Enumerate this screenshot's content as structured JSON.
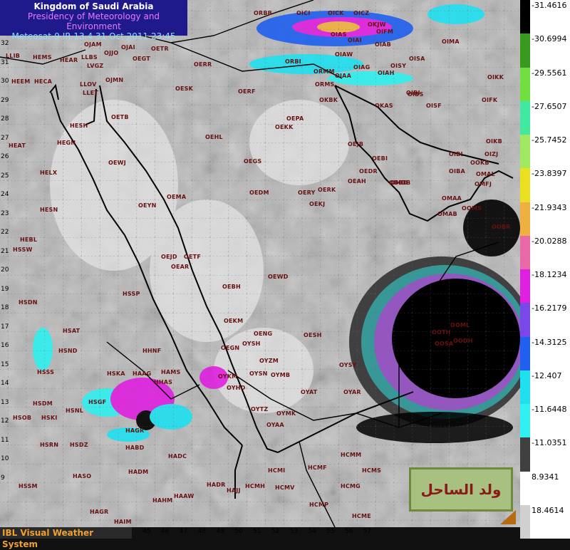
{
  "header": {
    "line1": "Kingdom of Saudi Arabia",
    "line2": "Presidency of Meteorology and Environment",
    "line3": "Meteosat-9 IR 13.4     31 Oct 2011 23:45"
  },
  "footer": {
    "text": "IBL Visual Weather System"
  },
  "stamp": {
    "text": "ولد الساحل"
  },
  "legend": [
    {
      "label": "-31.4616",
      "color": "#000000"
    },
    {
      "label": "-30.6994",
      "color": "#3a9a20"
    },
    {
      "label": "-29.5561",
      "color": "#70e040"
    },
    {
      "label": "-27.6507",
      "color": "#40e8a0"
    },
    {
      "label": "-25.7452",
      "color": "#a0e860"
    },
    {
      "label": "-23.8397",
      "color": "#e8e020"
    },
    {
      "label": "-21.9343",
      "color": "#f0b040"
    },
    {
      "label": "-20.0288",
      "color": "#e868a8"
    },
    {
      "label": "-18.1234",
      "color": "#e020e0"
    },
    {
      "label": "-16.2179",
      "color": "#7848e8"
    },
    {
      "label": "-14.3125",
      "color": "#2060f0"
    },
    {
      "label": "-12.407",
      "color": "#20e0f0"
    },
    {
      "label": "-11.6448",
      "color": "#30f0f0"
    },
    {
      "label": "-11.0351",
      "color": "#404040"
    },
    {
      "label": "8.9341",
      "color": "#ffffff"
    },
    {
      "label": "18.4614",
      "color": "#d0d0d0"
    }
  ],
  "x_ticks": [
    "36",
    "37",
    "38",
    "39",
    "40",
    "41",
    "42",
    "43",
    "44",
    "45",
    "46",
    "47",
    "48",
    "49",
    "50",
    "51",
    "52",
    "53",
    "54",
    "55",
    "56",
    "57"
  ],
  "y_ticks": [
    "32",
    "31",
    "30",
    "29",
    "28",
    "27",
    "26",
    "25",
    "24",
    "23",
    "22",
    "21",
    "20",
    "19",
    "18",
    "17",
    "16",
    "15",
    "14",
    "13",
    "12",
    "11",
    "10",
    "9"
  ],
  "stations": [
    {
      "id": "ORBB"
    },
    {
      "id": "OICI"
    },
    {
      "id": "OICK"
    },
    {
      "id": "OICZ"
    },
    {
      "id": "OIAS"
    },
    {
      "id": "OIAI"
    },
    {
      "id": "OIFM"
    },
    {
      "id": "OJAM"
    },
    {
      "id": "OJAI"
    },
    {
      "id": "OJJO"
    },
    {
      "id": "OETR"
    },
    {
      "id": "OEGT"
    },
    {
      "id": "HEAR"
    },
    {
      "id": "LLBS"
    },
    {
      "id": "LVGZ"
    },
    {
      "id": "HEMS"
    },
    {
      "id": "LLIB"
    },
    {
      "id": "OERR"
    },
    {
      "id": "HEEM"
    },
    {
      "id": "HECA"
    },
    {
      "id": "LLOV"
    },
    {
      "id": "LLET"
    },
    {
      "id": "OJMN"
    },
    {
      "id": "OESK"
    },
    {
      "id": "OERF"
    },
    {
      "id": "OETB"
    },
    {
      "id": "HESH"
    },
    {
      "id": "HEGN"
    },
    {
      "id": "HEAT"
    },
    {
      "id": "OEWJ"
    },
    {
      "id": "OEHL"
    },
    {
      "id": "OEPA"
    },
    {
      "id": "OEKK"
    },
    {
      "id": "HELX"
    },
    {
      "id": "OEGS"
    },
    {
      "id": "OEMA"
    },
    {
      "id": "OEDM"
    },
    {
      "id": "OERY"
    },
    {
      "id": "OERK"
    },
    {
      "id": "OEKJ"
    },
    {
      "id": "OEAH"
    },
    {
      "id": "HESN"
    },
    {
      "id": "OEYN"
    },
    {
      "id": "HEBL"
    },
    {
      "id": "HSSW"
    },
    {
      "id": "OEJD"
    },
    {
      "id": "OETF"
    },
    {
      "id": "OEAR"
    },
    {
      "id": "OEWD"
    },
    {
      "id": "HSSP"
    },
    {
      "id": "OEBH"
    },
    {
      "id": "HSDN"
    },
    {
      "id": "OEKM"
    },
    {
      "id": "OENG"
    },
    {
      "id": "OESH"
    },
    {
      "id": "HSAT"
    },
    {
      "id": "OYSH"
    },
    {
      "id": "HSND"
    },
    {
      "id": "HHNF"
    },
    {
      "id": "OEGN"
    },
    {
      "id": "OYZM"
    },
    {
      "id": "HSSS"
    },
    {
      "id": "HSKA"
    },
    {
      "id": "HAAG"
    },
    {
      "id": "HAMS"
    },
    {
      "id": "OYKM"
    },
    {
      "id": "OYSN"
    },
    {
      "id": "OYMB"
    },
    {
      "id": "OYSY"
    },
    {
      "id": "HHAS"
    },
    {
      "id": "OYHD"
    },
    {
      "id": "HSDM"
    },
    {
      "id": "HSGF"
    },
    {
      "id": "OYAT"
    },
    {
      "id": "OYAR"
    },
    {
      "id": "HSNL"
    },
    {
      "id": "OYTZ"
    },
    {
      "id": "OYMK"
    },
    {
      "id": "HSOB"
    },
    {
      "id": "HSKI"
    },
    {
      "id": "HAGR"
    },
    {
      "id": "OYAA"
    },
    {
      "id": "HABD"
    },
    {
      "id": "HSRN"
    },
    {
      "id": "HSDZ"
    },
    {
      "id": "HADC"
    },
    {
      "id": "HCMI"
    },
    {
      "id": "HCMF"
    },
    {
      "id": "HCMS"
    },
    {
      "id": "HASO"
    },
    {
      "id": "HADM"
    },
    {
      "id": "HSSM"
    },
    {
      "id": "HADR"
    },
    {
      "id": "HAJJ"
    },
    {
      "id": "HCMH"
    },
    {
      "id": "HCMV"
    },
    {
      "id": "HCMG"
    },
    {
      "id": "HAHM"
    },
    {
      "id": "HAAW"
    },
    {
      "id": "HCMP"
    },
    {
      "id": "HAGR"
    },
    {
      "id": "HAIM"
    },
    {
      "id": "HCME"
    },
    {
      "id": "HCMM"
    },
    {
      "id": "OKBK"
    },
    {
      "id": "OIAW"
    },
    {
      "id": "ORMM"
    },
    {
      "id": "OIAG"
    },
    {
      "id": "OIAH"
    },
    {
      "id": "OISY"
    },
    {
      "id": "OIKK"
    },
    {
      "id": "OIBS"
    },
    {
      "id": "OIKB"
    },
    {
      "id": "OIBL"
    },
    {
      "id": "OIZJ"
    },
    {
      "id": "OEJB"
    },
    {
      "id": "OEBI"
    },
    {
      "id": "OEDR"
    },
    {
      "id": "OMDB"
    },
    {
      "id": "OBBD"
    },
    {
      "id": "OMAA"
    },
    {
      "id": "OOKB"
    },
    {
      "id": "OMFJ"
    },
    {
      "id": "OMAL"
    },
    {
      "id": "OMAB"
    },
    {
      "id": "OIBA"
    },
    {
      "id": "OOMS"
    },
    {
      "id": "OOBR"
    },
    {
      "id": "OOTH"
    },
    {
      "id": "OOSA"
    },
    {
      "id": "OODH"
    },
    {
      "id": "OOML"
    },
    {
      "id": "OISF"
    },
    {
      "id": "OIFK"
    },
    {
      "id": "OKAS"
    },
    {
      "id": "OIBI"
    },
    {
      "id": "ORBI"
    },
    {
      "id": "OIAA"
    },
    {
      "id": "OISA"
    },
    {
      "id": "OKJW"
    },
    {
      "id": "OIMA"
    },
    {
      "id": "OIAB"
    },
    {
      "id": "ORMS"
    }
  ]
}
